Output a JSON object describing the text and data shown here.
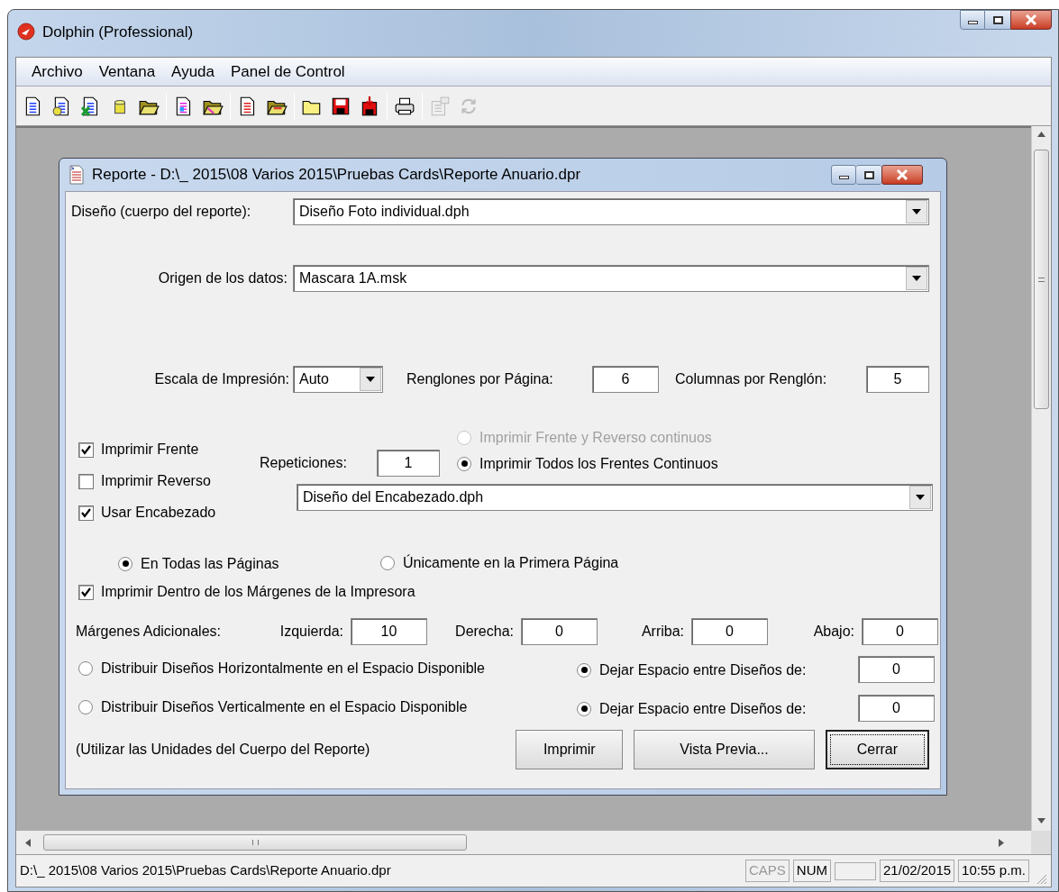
{
  "window": {
    "title": "Dolphin (Professional)"
  },
  "menu": [
    "Archivo",
    "Ventana",
    "Ayuda",
    "Panel de Control"
  ],
  "toolbar": [
    [
      {
        "kind": "document",
        "disabled": false
      },
      {
        "kind": "documents-db",
        "disabled": false
      },
      {
        "kind": "documents-sheet",
        "disabled": false
      },
      {
        "kind": "database",
        "disabled": false
      },
      {
        "kind": "open-folder",
        "disabled": false
      }
    ],
    [
      {
        "kind": "color-document",
        "disabled": false
      },
      {
        "kind": "color-folder",
        "disabled": false
      }
    ],
    [
      {
        "kind": "red-document",
        "disabled": false
      },
      {
        "kind": "red-folder",
        "disabled": false
      }
    ],
    [
      {
        "kind": "folder",
        "disabled": false
      },
      {
        "kind": "save",
        "disabled": false
      },
      {
        "kind": "save-arrow",
        "disabled": false
      }
    ],
    [
      {
        "kind": "printer",
        "disabled": false
      }
    ],
    [
      {
        "kind": "properties",
        "disabled": true
      },
      {
        "kind": "refresh",
        "disabled": true
      }
    ]
  ],
  "report_window": {
    "title": "Reporte - D:\\_  2015\\08 Varios 2015\\Pruebas Cards\\Reporte Anuario.dpr",
    "design": {
      "label": "Diseño (cuerpo del reporte):",
      "value": "Diseño Foto individual.dph"
    },
    "data_source": {
      "label": "Origen de los datos:",
      "value": "Mascara 1A.msk"
    },
    "scale": {
      "label": "Escala de Impresión:",
      "value": "Auto"
    },
    "rows_per_page": {
      "label": "Renglones por Página:",
      "value": "6"
    },
    "columns_per_row": {
      "label": "Columnas por Renglón:",
      "value": "5"
    },
    "print_checks": [
      {
        "label": "Imprimir Frente",
        "checked": true
      },
      {
        "label": "Imprimir Reverso",
        "checked": false
      }
    ],
    "repetitions": {
      "label": "Repeticiones:",
      "value": "1"
    },
    "continuous_mode": [
      {
        "label": "Imprimir Frente y Reverso continuos",
        "selected": false,
        "disabled": true
      },
      {
        "label": "Imprimir Todos los Frentes Continuos",
        "selected": true,
        "disabled": false
      }
    ],
    "header": {
      "label": "Usar Encabezado",
      "checked": true,
      "value": "Diseño del Encabezado.dph"
    },
    "header_pages": [
      {
        "label": "En Todas las Páginas",
        "selected": true
      },
      {
        "label": "Únicamente en la Primera Página",
        "selected": false
      }
    ],
    "inside_margins": {
      "label": "Imprimir Dentro de los Márgenes de la Impresora",
      "checked": true
    },
    "margins": {
      "label": "Márgenes Adicionales:",
      "items": [
        {
          "label": "Izquierda:",
          "value": "10"
        },
        {
          "label": "Derecha:",
          "value": "0"
        },
        {
          "label": "Arriba:",
          "value": "0"
        },
        {
          "label": "Abajo:",
          "value": "0"
        }
      ]
    },
    "distribution": [
      {
        "label": "Distribuir Diseños Horizontalmente en el Espacio Disponible",
        "selected": false,
        "spacing_label": "Dejar Espacio entre Diseños de:",
        "spacing_selected": true,
        "value": "0"
      },
      {
        "label": "Distribuir Diseños Verticalmente en el Espacio Disponible",
        "selected": false,
        "spacing_label": "Dejar Espacio entre Diseños de:",
        "spacing_selected": true,
        "value": "0"
      }
    ],
    "note": "(Utilizar las Unidades del Cuerpo del Reporte)",
    "buttons": [
      {
        "label": "Imprimir",
        "focused": false
      },
      {
        "label": "Vista Previa...",
        "focused": false
      },
      {
        "label": "Cerrar",
        "focused": true
      }
    ]
  },
  "status_bar": {
    "path": "D:\\_  2015\\08 Varios 2015\\Pruebas Cards\\Reporte Anuario.dpr",
    "indicators": [
      {
        "label": "CAPS",
        "active": false
      },
      {
        "label": "NUM",
        "active": true
      }
    ],
    "date": "21/02/2015",
    "time": "10:55 p.m."
  }
}
